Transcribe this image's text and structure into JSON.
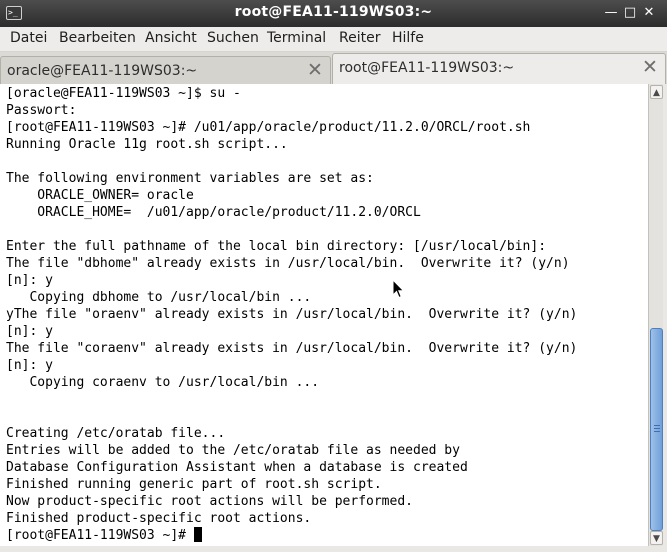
{
  "window": {
    "title": "root@FEA11-119WS03:~",
    "app_icon": ">_",
    "controls": {
      "minimize": "—",
      "maximize": "□",
      "close": "✕"
    }
  },
  "menu": {
    "items": [
      {
        "label": "Datei"
      },
      {
        "label": "Bearbeiten"
      },
      {
        "label": "Ansicht"
      },
      {
        "label": "Suchen"
      },
      {
        "label": "Terminal"
      },
      {
        "label": "Reiter"
      },
      {
        "label": "Hilfe"
      }
    ]
  },
  "tabs": [
    {
      "label": "oracle@FEA11-119WS03:~",
      "active": false,
      "close": "✕"
    },
    {
      "label": "root@FEA11-119WS03:~",
      "active": true,
      "close": "✕"
    }
  ],
  "terminal": {
    "lines": [
      "[oracle@FEA11-119WS03 ~]$ su -",
      "Passwort:",
      "[root@FEA11-119WS03 ~]# /u01/app/oracle/product/11.2.0/ORCL/root.sh",
      "Running Oracle 11g root.sh script...",
      "",
      "The following environment variables are set as:",
      "    ORACLE_OWNER= oracle",
      "    ORACLE_HOME=  /u01/app/oracle/product/11.2.0/ORCL",
      "",
      "Enter the full pathname of the local bin directory: [/usr/local/bin]:",
      "The file \"dbhome\" already exists in /usr/local/bin.  Overwrite it? (y/n)",
      "[n]: y",
      "   Copying dbhome to /usr/local/bin ...",
      "yThe file \"oraenv\" already exists in /usr/local/bin.  Overwrite it? (y/n)",
      "[n]: y",
      "The file \"coraenv\" already exists in /usr/local/bin.  Overwrite it? (y/n)",
      "[n]: y",
      "   Copying coraenv to /usr/local/bin ...",
      "",
      "",
      "Creating /etc/oratab file...",
      "Entries will be added to the /etc/oratab file as needed by",
      "Database Configuration Assistant when a database is created",
      "Finished running generic part of root.sh script.",
      "Now product-specific root actions will be performed.",
      "Finished product-specific root actions."
    ],
    "prompt": "[root@FEA11-119WS03 ~]# "
  },
  "scrollbar": {
    "up_arrow": "▲",
    "down_arrow": "▼",
    "thumb_start": 0.53,
    "thumb_end": 1.0
  },
  "colors": {
    "titlebar": "#2c2c2c",
    "terminal_bg": "#ffffff",
    "terminal_fg": "#000000",
    "scroll_thumb": "#6f9fd8"
  }
}
